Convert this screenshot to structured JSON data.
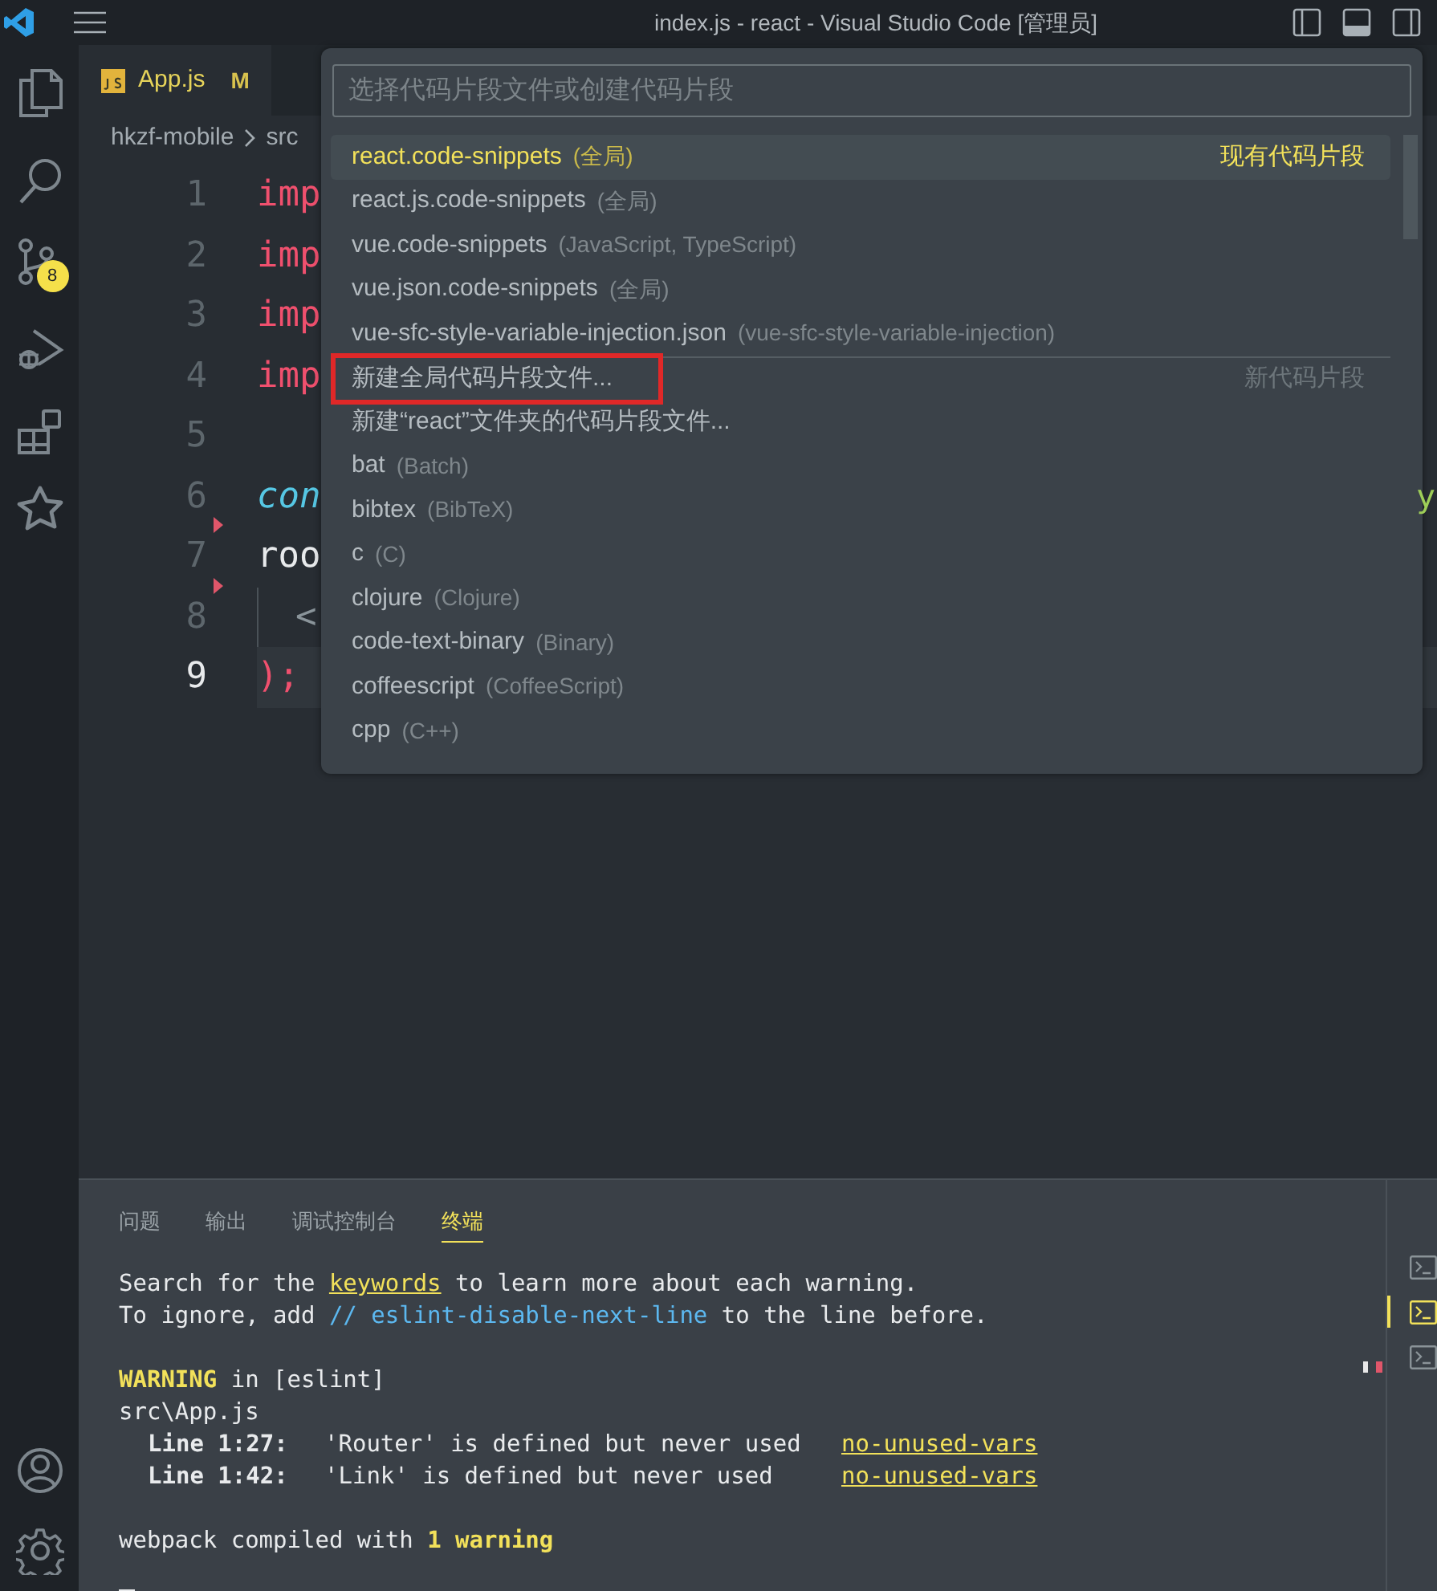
{
  "window": {
    "title": "index.js - react - Visual Studio Code [管理员]"
  },
  "activity_bar": {
    "source_control_badge": "8"
  },
  "editor_tab": {
    "label": "App.js",
    "status": "M"
  },
  "breadcrumbs": [
    "hkzf-mobile",
    "src"
  ],
  "code_lines": [
    {
      "number": "1",
      "kind": "keyword",
      "text": "imp",
      "current": false,
      "deleted_marker": false
    },
    {
      "number": "2",
      "kind": "keyword",
      "text": "imp",
      "current": false,
      "deleted_marker": false
    },
    {
      "number": "3",
      "kind": "keyword",
      "text": "imp",
      "current": false,
      "deleted_marker": false
    },
    {
      "number": "4",
      "kind": "keyword",
      "text": "imp",
      "current": false,
      "deleted_marker": false
    },
    {
      "number": "5",
      "kind": "blank",
      "current": false,
      "deleted_marker": false
    },
    {
      "number": "6",
      "kind": "storage",
      "text": "con",
      "tail": "y",
      "current": false,
      "deleted_marker": false
    },
    {
      "number": "7",
      "kind": "plain",
      "text": "roo",
      "current": false,
      "deleted_marker": true
    },
    {
      "number": "8",
      "kind": "tag",
      "text": "<",
      "current": false,
      "deleted_marker": true
    },
    {
      "number": "9",
      "kind": "paren",
      "text": ");",
      "current": true,
      "deleted_marker": false
    }
  ],
  "quick_pick": {
    "placeholder": "选择代码片段文件或创建代码片段",
    "items": [
      {
        "label": "react.code-snippets",
        "description": "(全局)",
        "group": "现有代码片段",
        "selected": true,
        "separator": false,
        "annotated": false
      },
      {
        "label": "react.js.code-snippets",
        "description": "(全局)",
        "selected": false,
        "separator": false,
        "annotated": false
      },
      {
        "label": "vue.code-snippets",
        "description": "(JavaScript, TypeScript)",
        "selected": false,
        "separator": false,
        "annotated": false
      },
      {
        "label": "vue.json.code-snippets",
        "description": "(全局)",
        "selected": false,
        "separator": false,
        "annotated": false
      },
      {
        "label": "vue-sfc-style-variable-injection.json",
        "description": "(vue-sfc-style-variable-injection)",
        "selected": false,
        "separator": false,
        "annotated": false
      },
      {
        "label": "新建全局代码片段文件...",
        "group": "新代码片段",
        "selected": false,
        "separator": true,
        "annotated": true
      },
      {
        "label": "新建“react”文件夹的代码片段文件...",
        "selected": false,
        "separator": false,
        "annotated": false
      },
      {
        "label": "bat",
        "description": "(Batch)",
        "selected": false,
        "separator": false,
        "annotated": false
      },
      {
        "label": "bibtex",
        "description": "(BibTeX)",
        "selected": false,
        "separator": false,
        "annotated": false
      },
      {
        "label": "c",
        "description": "(C)",
        "selected": false,
        "separator": false,
        "annotated": false
      },
      {
        "label": "clojure",
        "description": "(Clojure)",
        "selected": false,
        "separator": false,
        "annotated": false
      },
      {
        "label": "code-text-binary",
        "description": "(Binary)",
        "selected": false,
        "separator": false,
        "annotated": false
      },
      {
        "label": "coffeescript",
        "description": "(CoffeeScript)",
        "selected": false,
        "separator": false,
        "annotated": false
      },
      {
        "label": "cpp",
        "description": "(C++)",
        "selected": false,
        "separator": false,
        "annotated": false
      }
    ]
  },
  "panel": {
    "tabs": [
      {
        "label": "问题",
        "selected": false
      },
      {
        "label": "输出",
        "selected": false
      },
      {
        "label": "调试控制台",
        "selected": false
      },
      {
        "label": "终端",
        "selected": true
      }
    ],
    "terminal_blocks": [
      [
        {
          "kind": "message",
          "parts": [
            "Search for the ",
            "keywords",
            " to learn more about each warning."
          ]
        },
        {
          "kind": "hint",
          "parts": [
            "To ignore, add ",
            "// eslint-disable-next-line",
            " to the line before."
          ]
        }
      ],
      [
        {
          "kind": "heading",
          "parts": [
            "WARNING",
            " in [eslint]"
          ]
        },
        {
          "kind": "file",
          "parts": [
            "src\\App.js"
          ]
        },
        {
          "kind": "problem",
          "parts": [
            "Line 1:27:",
            "'Router' is defined but never used",
            "no-unused-vars"
          ]
        },
        {
          "kind": "problem",
          "parts": [
            "Line 1:42:",
            "'Link' is defined but never used",
            "no-unused-vars"
          ]
        }
      ],
      [
        {
          "kind": "summary",
          "parts": [
            "webpack compiled with ",
            "1 warning"
          ]
        }
      ]
    ],
    "terminals": [
      {
        "selected": false
      },
      {
        "selected": true
      },
      {
        "selected": false
      }
    ]
  }
}
